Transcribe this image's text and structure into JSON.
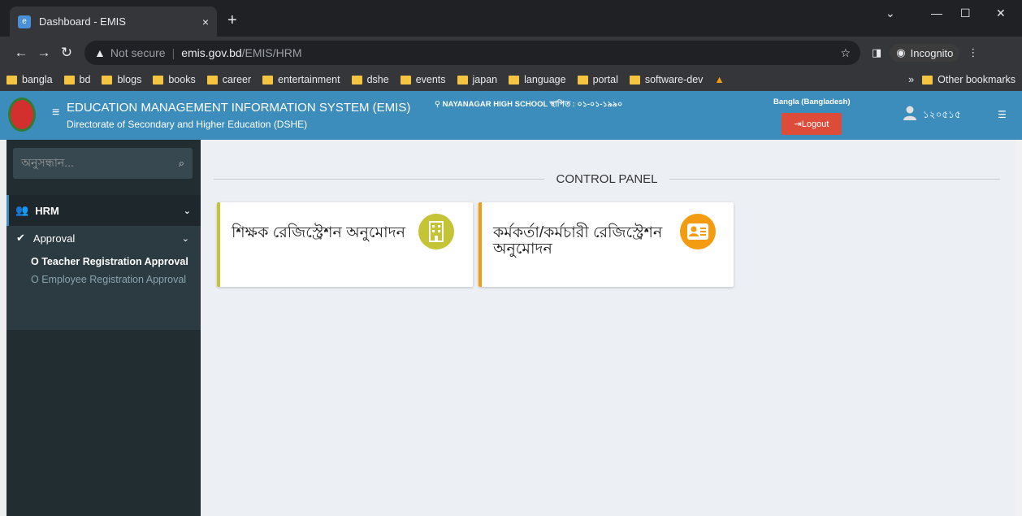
{
  "browser": {
    "tab_title": "Dashboard - EMIS",
    "tab_close": "×",
    "new_tab": "+",
    "security_label": "Not secure",
    "url_host": "emis.gov.bd",
    "url_path": "/EMIS/HRM",
    "profile_label": "Incognito",
    "bookmarks": [
      "bangla",
      "bd",
      "blogs",
      "books",
      "career",
      "entertainment",
      "dshe",
      "events",
      "japan",
      "language",
      "portal",
      "software-dev"
    ],
    "bookmarks_overflow": "»",
    "other_bookmarks": "Other bookmarks"
  },
  "header": {
    "system_title": "EDUCATION MANAGEMENT INFORMATION SYSTEM (EMIS)",
    "system_subtitle": "Directorate of Secondary and Higher Education (DSHE)",
    "school": "NAYANAGAR HIGH SCHOOL   স্থাপিত : ০১-০১-১৯৯০",
    "language": "Bangla (Bangladesh)",
    "logout_label": "Logout",
    "user_id": "১২০৫১৫"
  },
  "sidebar": {
    "search_placeholder": "অনুসন্ধান...",
    "hrm_label": "HRM",
    "approval_label": "Approval",
    "items": [
      {
        "label": "Teacher Registration Approval"
      },
      {
        "label": "Employee Registration Approval"
      }
    ]
  },
  "main": {
    "panel_title": "CONTROL PANEL",
    "cards": [
      {
        "label": "শিক্ষক রেজিস্ট্রেশন অনুমোদন",
        "icon": "building-icon"
      },
      {
        "label": "কর্মকর্তা/কর্মচারী রেজিস্ট্রেশন অনুমোদন",
        "icon": "id-card-icon"
      }
    ]
  },
  "colors": {
    "header_bg": "#3c8dbc",
    "sidebar_bg": "#222d32",
    "logout_bg": "#dd4b39",
    "card1_accent": "#c5c437",
    "card2_accent": "#f39c12"
  }
}
